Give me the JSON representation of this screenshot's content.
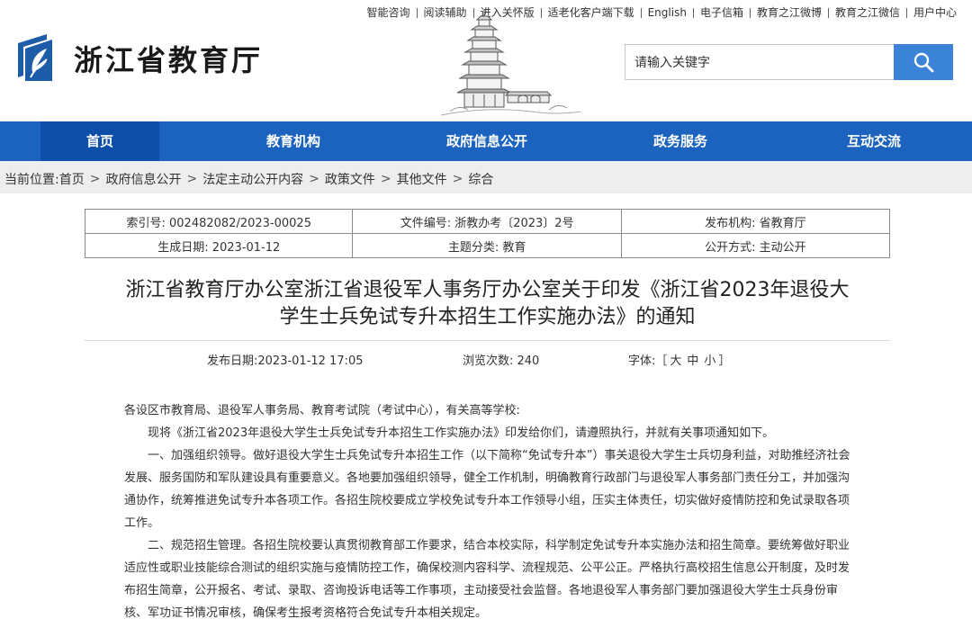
{
  "toplinks": [
    "智能咨询",
    "阅读辅助",
    "进入关怀版",
    "适老化客户端下载",
    "English",
    "电子信箱",
    "教育之江微博",
    "教育之江微信",
    "用户中心"
  ],
  "site": {
    "title": "浙江省教育厅",
    "brand_color": "#1b63be"
  },
  "search": {
    "placeholder": "请输入关键字"
  },
  "nav": {
    "items": [
      "首页",
      "教育机构",
      "政府信息公开",
      "政务服务",
      "互动交流"
    ],
    "active": "首页"
  },
  "breadcrumb": {
    "label": "当前位置:",
    "items": [
      "首页",
      "政府信息公开",
      "法定主动公开内容",
      "政策文件",
      "其他文件",
      "综合"
    ]
  },
  "meta": {
    "index_no": "索引号: 002482082/2023-00025",
    "doc_no": "文件编号: 浙教办考〔2023〕2号",
    "issuer": "发布机构: 省教育厅",
    "created": "生成日期: 2023-01-12",
    "topic": "主题分类: 教育",
    "disclosure": "公开方式: 主动公开"
  },
  "article": {
    "title_line1": "浙江省教育厅办公室浙江省退役军人事务厅办公室关于印发《浙江省2023年退役大",
    "title_line2": "学生士兵免试专升本招生工作实施办法》的通知",
    "publish_date": "发布日期:2023-01-12 17:05",
    "views": "浏览次数: 240",
    "font_label": "字体:［",
    "font_large": "大",
    "font_medium": "中",
    "font_small": "小",
    "font_close": "］",
    "paragraphs": [
      "各设区市教育局、退役军人事务局、教育考试院（考试中心），有关高等学校:",
      "现将《浙江省2023年退役大学生士兵免试专升本招生工作实施办法》印发给你们，请遵照执行，并就有关事项通知如下。",
      "一、加强组织领导。做好退役大学生士兵免试专升本招生工作（以下简称“免试专升本”）事关退役大学生士兵切身利益，对助推经济社会发展、服务国防和军队建设具有重要意义。各地要加强组织领导，健全工作机制，明确教育行政部门与退役军人事务部门责任分工，并加强沟通协作，统筹推进免试专升本各项工作。各招生院校要成立学校免试专升本工作领导小组，压实主体责任，切实做好疫情防控和免试录取各项工作。",
      "二、规范招生管理。各招生院校要认真贯彻教育部工作要求，结合本校实际，科学制定免试专升本实施办法和招生简章。要统筹做好职业适应性或职业技能综合测试的组织实施与疫情防控工作，确保校测内容科学、流程规范、公平公正。严格执行高校招生信息公开制度，及时发布招生简章，公开报名、考试、录取、咨询投诉电话等工作事项，主动接受社会监督。各地退役军人事务部门要加强退役大学生士兵身份审核、军功证书情况审核，确保考生报考资格符合免试专升本相关规定。"
    ]
  }
}
